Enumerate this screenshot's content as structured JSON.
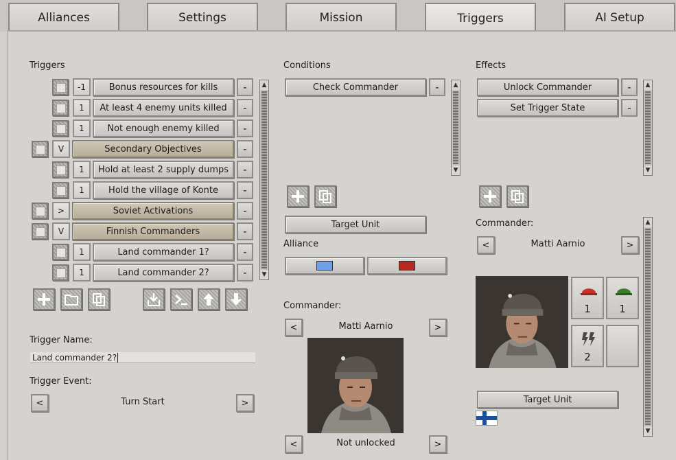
{
  "tabs": [
    {
      "label": "Alliances"
    },
    {
      "label": "Settings"
    },
    {
      "label": "Mission"
    },
    {
      "label": "Triggers"
    },
    {
      "label": "AI Setup"
    }
  ],
  "triggers": {
    "title": "Triggers",
    "items": [
      {
        "num": "-1",
        "label": "Bonus resources for kills",
        "minus": "-"
      },
      {
        "num": "1",
        "label": "At least 4 enemy units killed",
        "minus": "-"
      },
      {
        "num": "1",
        "label": "Not enough enemy killed",
        "minus": "-"
      },
      {
        "num": "V",
        "label": "Secondary Objectives",
        "minus": "-"
      },
      {
        "num": "1",
        "label": "Hold at least 2 supply dumps",
        "minus": "-"
      },
      {
        "num": "1",
        "label": "Hold the village of Konte",
        "minus": "-"
      },
      {
        "num": ">",
        "label": "Soviet Activations",
        "minus": "-"
      },
      {
        "num": "V",
        "label": "Finnish Commanders",
        "minus": "-"
      },
      {
        "num": "1",
        "label": "Land commander 1?",
        "minus": "-"
      },
      {
        "num": "1",
        "label": "Land commander 2?",
        "minus": "-"
      }
    ],
    "name_label": "Trigger Name:",
    "name_value": "Land commander 2?",
    "event_label": "Trigger Event:",
    "event_value": "Turn Start",
    "prev": "<",
    "next": ">"
  },
  "conditions": {
    "title": "Conditions",
    "items": [
      {
        "label": "Check Commander",
        "minus": "-"
      }
    ],
    "target_unit": "Target Unit",
    "alliance_label": "Alliance",
    "alliance_colors": [
      "#6f9fe6",
      "#b52a1e"
    ],
    "commander_label": "Commander:",
    "commander_name": "Matti Aarnio",
    "status": "Not unlocked",
    "prev": "<",
    "next": ">"
  },
  "effects": {
    "title": "Effects",
    "items": [
      {
        "label": "Unlock Commander",
        "minus": "-"
      },
      {
        "label": "Set Trigger State",
        "minus": "-"
      }
    ],
    "commander_label": "Commander:",
    "commander_name": "Matti Aarnio",
    "resources": [
      {
        "icon": "red-helmet-icon",
        "value": "1"
      },
      {
        "icon": "green-helmet-icon",
        "value": "1"
      },
      {
        "icon": "lightning-icon",
        "value": "2"
      },
      {
        "icon": "empty",
        "value": ""
      }
    ],
    "target_unit": "Target Unit",
    "prev": "<",
    "next": ">"
  },
  "colors": {
    "secondary": "#c3b9a5",
    "accent_red": "#c8322a",
    "accent_green": "#3f7a2d"
  }
}
